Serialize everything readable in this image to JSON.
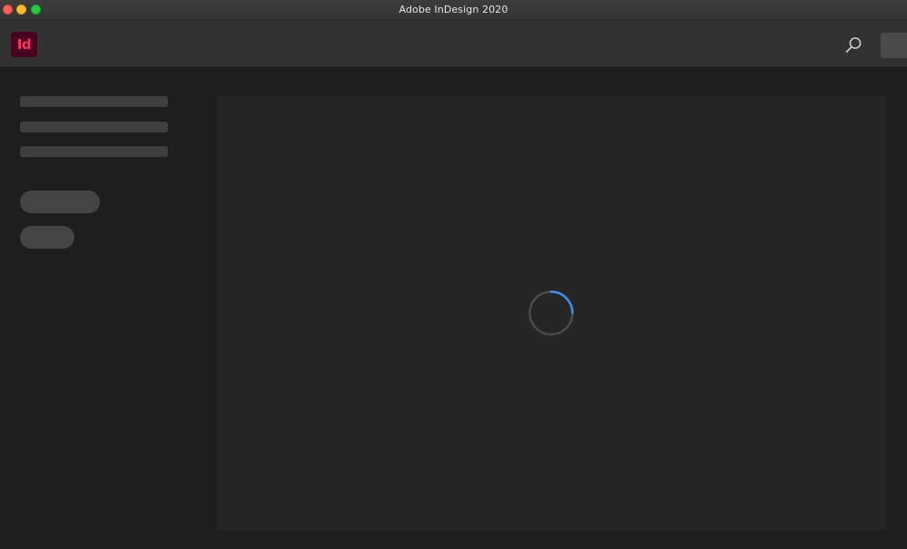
{
  "window": {
    "title": "Adobe InDesign 2020"
  },
  "header": {
    "app_logo_text": "Id",
    "icons": {
      "search": "search-icon"
    }
  },
  "colors": {
    "logo_background": "#49021f",
    "logo_text": "#ff3366",
    "spinner_accent": "#3b8ef0",
    "spinner_track": "#4a4a4a"
  },
  "status": {
    "loading": true
  }
}
